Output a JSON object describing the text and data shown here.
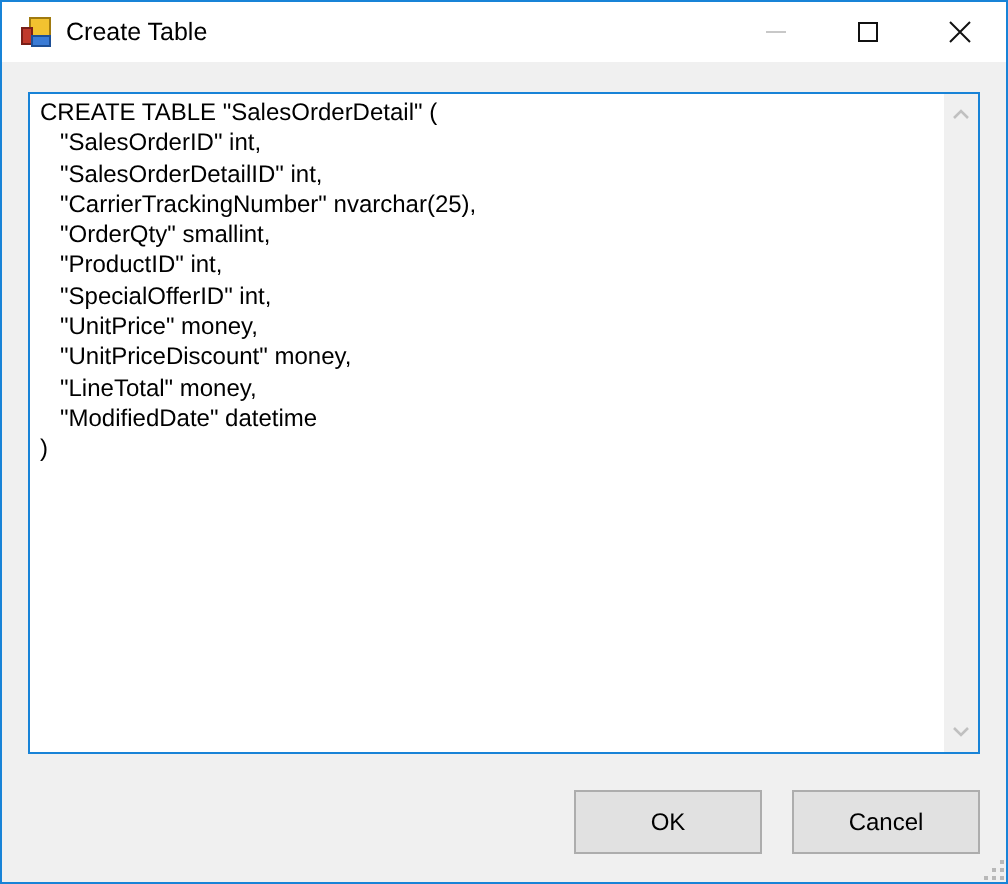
{
  "window": {
    "title": "Create Table"
  },
  "editor": {
    "lines": [
      "CREATE TABLE \"SalesOrderDetail\" (",
      "   \"SalesOrderID\" int,",
      "   \"SalesOrderDetailID\" int,",
      "   \"CarrierTrackingNumber\" nvarchar(25),",
      "   \"OrderQty\" smallint,",
      "   \"ProductID\" int,",
      "   \"SpecialOfferID\" int,",
      "   \"UnitPrice\" money,",
      "   \"UnitPriceDiscount\" money,",
      "   \"LineTotal\" money,",
      "   \"ModifiedDate\" datetime",
      ")"
    ]
  },
  "buttons": [
    "OK",
    "Cancel"
  ]
}
